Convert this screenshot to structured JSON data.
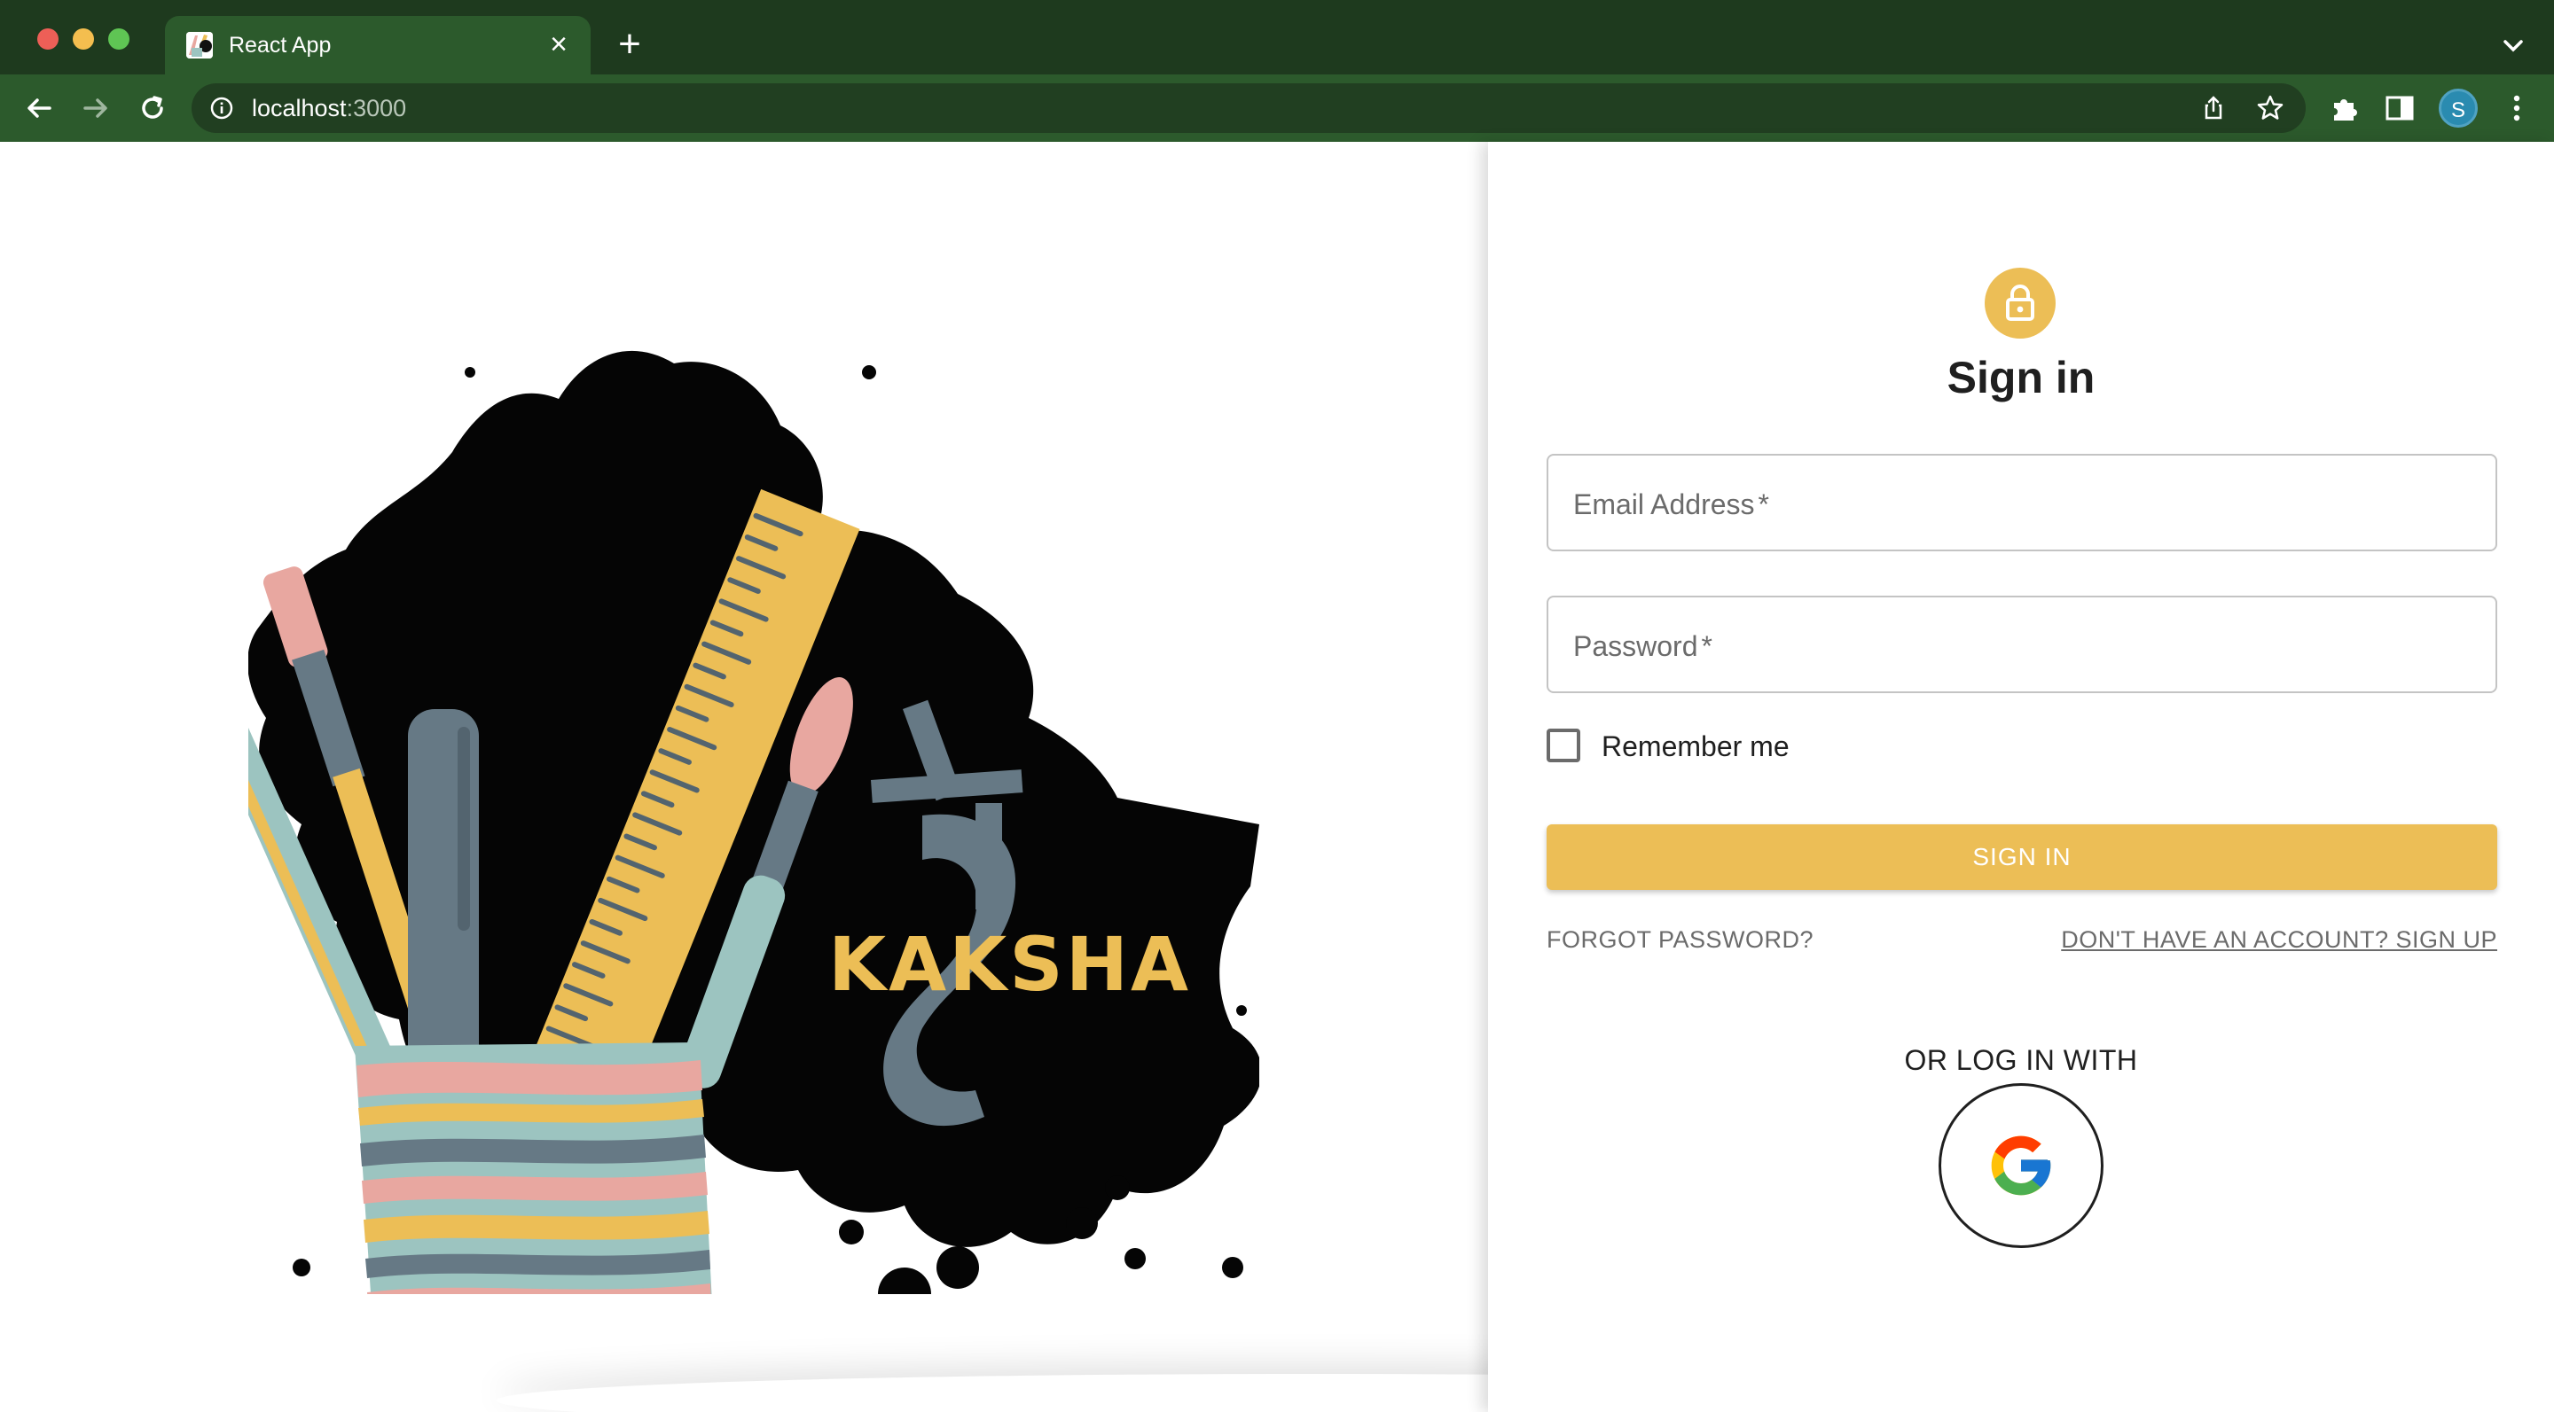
{
  "browser": {
    "tab_title": "React App",
    "url_host": "localhost",
    "url_port": ":3000",
    "profile_initial": "S"
  },
  "brand": {
    "logo_text": "KAKSHA",
    "logo_glyph": "क्ष"
  },
  "signin": {
    "title": "Sign in",
    "email_label": "Email Address",
    "password_label": "Password",
    "required_marker": "*",
    "remember_label": "Remember me",
    "submit_label": "SIGN IN",
    "forgot_link": "FORGOT PASSWORD?",
    "signup_link": "DON'T HAVE AN ACCOUNT? SIGN UP",
    "or_label": "OR LOG IN WITH"
  },
  "colors": {
    "accent": "#ecbe56",
    "browser_frame": "#2c5a2c"
  },
  "icons": {
    "lock": "lock-icon",
    "google": "google-icon"
  }
}
